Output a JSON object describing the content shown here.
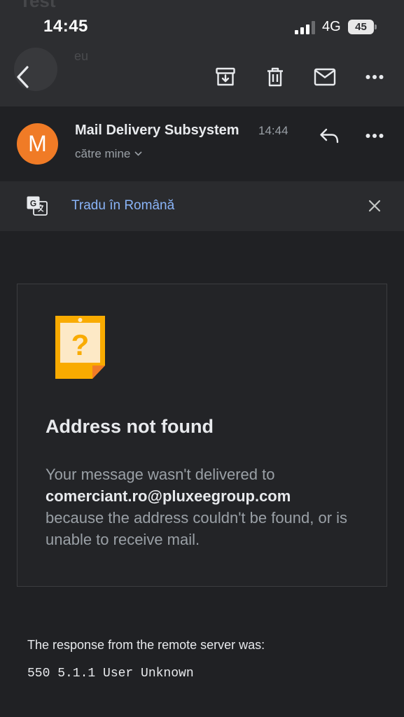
{
  "status_bar": {
    "time": "14:45",
    "network": "4G",
    "battery": "45"
  },
  "background": {
    "subject": "Test",
    "sender": "eu"
  },
  "toolbar": {
    "back_icon": "arrow-left-icon",
    "archive_icon": "archive-icon",
    "delete_icon": "trash-icon",
    "mark_unread_icon": "mail-icon",
    "more_icon": "more-horizontal-icon"
  },
  "message": {
    "avatar_letter": "M",
    "avatar_color": "#f07b26",
    "sender": "Mail Delivery Subsystem",
    "time": "14:44",
    "recipient": "către mine"
  },
  "translate": {
    "label": "Tradu în Română"
  },
  "card": {
    "title": "Address not found",
    "body_prefix": "Your message wasn't delivered to",
    "email": "comerciant.ro@pluxeegroup.com",
    "body_suffix": "because the address couldn't be found, or is unable to receive mail."
  },
  "response": {
    "label": "The response from the remote server was:",
    "code": "550 5.1.1 User Unknown"
  },
  "colors": {
    "background": "#202124",
    "toolbar": "#2d2e31",
    "accent_link": "#8ab4f8",
    "warning_icon": "#f9ab00"
  }
}
